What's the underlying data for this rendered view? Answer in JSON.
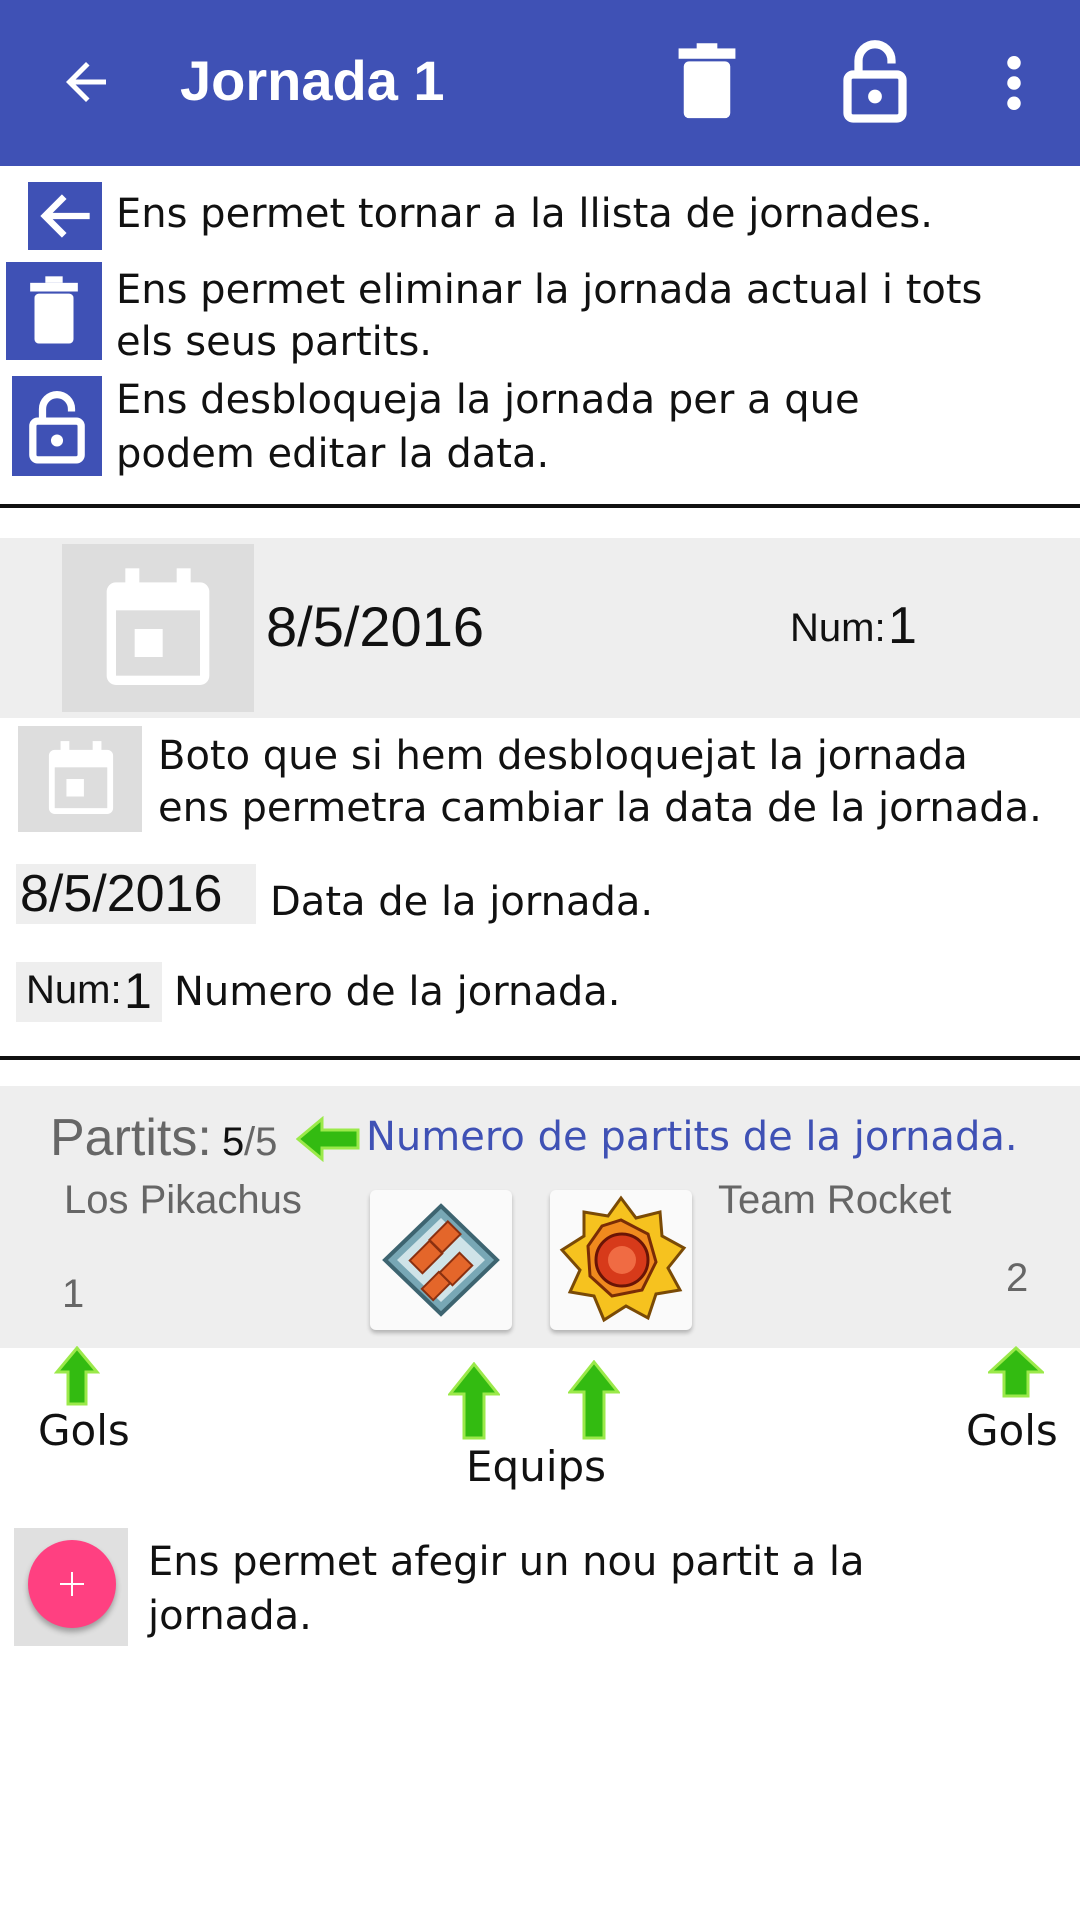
{
  "appbar": {
    "title": "Jornada 1",
    "back_icon": "arrow-left-icon",
    "delete_icon": "trash-icon",
    "lock_icon": "lock-open-icon",
    "menu_icon": "more-vert-icon",
    "color": "#3f51b5"
  },
  "legend": {
    "back": "Ens permet tornar a la llista de jornades.",
    "delete_line1": "Ens permet eliminar la jornada actual i tots",
    "delete_line2": "els seus partits.",
    "lock_line1": "Ens desbloqueja la jornada per a que",
    "lock_line2": "podem editar la data."
  },
  "jornada_card": {
    "date": "8/5/2016",
    "num_label": "Num:",
    "num_value": "1",
    "calendar_icon": "calendar-icon"
  },
  "explain": {
    "calendar_line1": "Boto que si hem desbloquejat la jornada",
    "calendar_line2": "ens permetra cambiar la data de la jornada.",
    "date_sample": "8/5/2016",
    "date_desc": "Data de la jornada.",
    "num_label": "Num:",
    "num_value": "1",
    "num_desc": "Numero de la jornada."
  },
  "matches": {
    "label": "Partits:",
    "count": "5",
    "total": "/5",
    "count_desc": "Numero de partits de la jornada.",
    "count_desc_color": "#3f51b5",
    "home_team": "Los Pikachus",
    "away_team": "Team Rocket",
    "home_score": "1",
    "away_score": "2",
    "home_logo_icon": "boulder-badge-icon",
    "away_logo_icon": "volcano-badge-icon"
  },
  "annotations": {
    "gols_left": "Gols",
    "gols_right": "Gols",
    "equips": "Equips",
    "arrow_color": "#33bb11"
  },
  "fab": {
    "icon": "plus-icon",
    "color": "#ff4081",
    "desc_line1": "Ens permet afegir un nou partit a la",
    "desc_line2": "jornada."
  }
}
